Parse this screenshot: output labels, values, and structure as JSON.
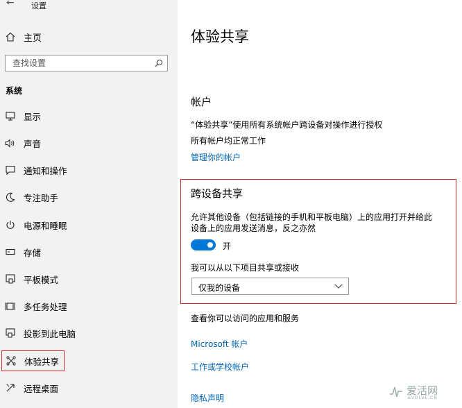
{
  "window": {
    "title": "设置",
    "back_symbol": "←"
  },
  "sidebar": {
    "home_label": "主页",
    "search_placeholder": "查找设置",
    "section": "系统",
    "items": [
      {
        "label": "显示",
        "icon": "display-icon"
      },
      {
        "label": "声音",
        "icon": "sound-icon"
      },
      {
        "label": "通知和操作",
        "icon": "notification-icon"
      },
      {
        "label": "专注助手",
        "icon": "moon-icon"
      },
      {
        "label": "电源和睡眠",
        "icon": "power-icon"
      },
      {
        "label": "存储",
        "icon": "storage-icon"
      },
      {
        "label": "平板模式",
        "icon": "tablet-icon"
      },
      {
        "label": "多任务处理",
        "icon": "multitask-icon"
      },
      {
        "label": "投影到此电脑",
        "icon": "project-icon"
      },
      {
        "label": "体验共享",
        "icon": "share-icon",
        "selected": true
      },
      {
        "label": "远程桌面",
        "icon": "remote-desktop-icon"
      }
    ]
  },
  "main": {
    "title": "体验共享",
    "accounts": {
      "heading": "帐户",
      "line1": "“体验共享”使用所有系统帐户跨设备对操作进行授权",
      "line2": "所有帐户均正常工作",
      "link": "管理你的帐户"
    },
    "cross_device": {
      "heading": "跨设备共享",
      "desc1": "允许其他设备（包括链接的手机和平板电脑）上的应用打开并给此",
      "desc2": "设备上的应用发送消息，反之亦然",
      "toggle_label": "开",
      "toggle_on": true,
      "share_label": "我可以从以下项目共享或接收",
      "dropdown_value": "仅我的设备"
    },
    "services": {
      "text": "查看你可以访问的应用和服务",
      "link1": "Microsoft 帐户",
      "link2": "工作或学校帐户"
    },
    "privacy_link": "隐私声明"
  },
  "watermark": {
    "text": "爱活网",
    "sub": "EVOLVE.CN"
  },
  "colors": {
    "accent": "#0078d7",
    "link": "#0066b4",
    "highlight": "#d32f2f",
    "sidebar_bg": "#f2f2f2"
  }
}
